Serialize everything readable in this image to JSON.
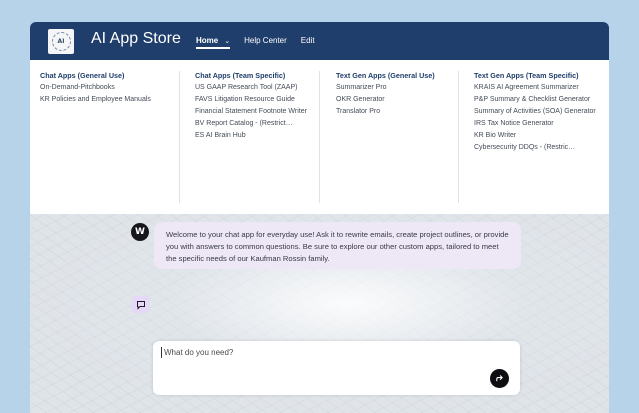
{
  "header": {
    "logo_text": "AI",
    "app_title": "AI App Store",
    "nav": [
      {
        "label": "Home",
        "active": true
      },
      {
        "label": "Help Center"
      },
      {
        "label": "Edit"
      }
    ]
  },
  "menu": {
    "columns": [
      {
        "title": "Chat Apps (General Use)",
        "items": [
          "On-Demand-Pitchbooks",
          "KR Policies and Employee Manuals"
        ]
      },
      {
        "title": "Chat Apps (Team Specific)",
        "items": [
          "US GAAP Research Tool (ZAAP)",
          "FAVS Litigation Resource Guide",
          "Financial Statement Footnote Writer",
          "BV Report Catalog - (Restrict…",
          "ES AI Brain Hub"
        ]
      },
      {
        "title": "Text Gen Apps (General Use)",
        "items": [
          "Summarizer Pro",
          "OKR Generator",
          "Translator Pro"
        ]
      },
      {
        "title": "Text Gen Apps (Team Specific)",
        "items": [
          "KRAIS AI Agreement Summarizer",
          "P&P Summary & Checklist Generator",
          "Summary of Activities (SOA) Generator",
          "IRS Tax Notice Generator",
          "KR Bio Writer",
          "Cybersecurity DDQs - (Restric…"
        ]
      }
    ]
  },
  "chat": {
    "avatar_letter": "W",
    "welcome": "Welcome to your chat app for everyday use! Ask it to rewrite emails, create project outlines, or provide you with answers to common questions. Be sure to explore our other custom apps, tailored to meet the specific needs of our Kaufman Rossin family.",
    "input_placeholder": "What do you need?"
  },
  "colors": {
    "header_bg": "#1f3e6b",
    "page_bg": "#b7d3ea",
    "bubble_bg": "#ede7f6",
    "send_button": "#0e0e12"
  },
  "icons": [
    "chevron-down-icon",
    "chat-icon",
    "send-icon"
  ]
}
